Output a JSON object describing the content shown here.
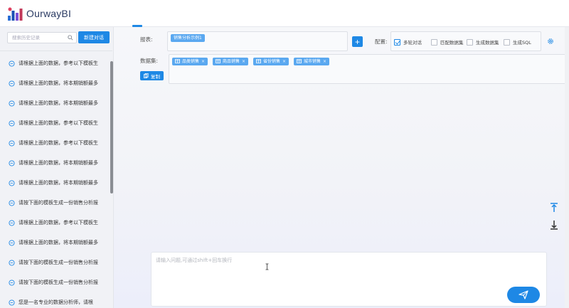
{
  "app": {
    "brand": "OurwayBI"
  },
  "sidebar": {
    "search_placeholder": "搜索历史记录",
    "new_chat_label": "新建对话",
    "history": [
      "请根据上面的数据，参考以下模板生",
      "请根据上面的数据，将本期销额最多",
      "请根据上面的数据，将本期销额最多",
      "请根据上面的数据，参考以下模板生",
      "请根据上面的数据，参考以下模板生",
      "请根据上面的数据，将本期销额最多",
      "请根据上面的数据，将本期销额最多",
      "请按下面的模板生成一份销售分析报",
      "请根据上面的数据，参考以下模板生",
      "请根据上面的数据，将本期销额最多",
      "请按下面的模板生成一份销售分析报",
      "请按下面的模板生成一份销售分析报",
      "您是一名专业的数据分析师，请根"
    ]
  },
  "main": {
    "report_label": "报表:",
    "report_tag": "销售分析示例1",
    "config_label": "配置:",
    "options": [
      {
        "label": "多轮对话",
        "checked": true
      },
      {
        "label": "匹配数据集",
        "checked": false
      },
      {
        "label": "生成数据集",
        "checked": false
      },
      {
        "label": "生成SQL",
        "checked": false
      }
    ],
    "dataset_label": "数据集:",
    "datasets": [
      "品类销售",
      "商品销售",
      "省份销售",
      "城市销售"
    ],
    "copy_label": "复制",
    "input_placeholder": "请输入问题,可通过shift+回车换行"
  },
  "colors": {
    "accent": "#1e88e5",
    "tag": "#5aa8f0",
    "brand_text": "#2b3b63"
  },
  "icons": [
    "search-icon",
    "chat-bubble-icon",
    "gear-icon",
    "copy-icon",
    "table-icon",
    "scroll-top-icon",
    "scroll-bottom-icon",
    "send-icon",
    "text-cursor-icon"
  ]
}
